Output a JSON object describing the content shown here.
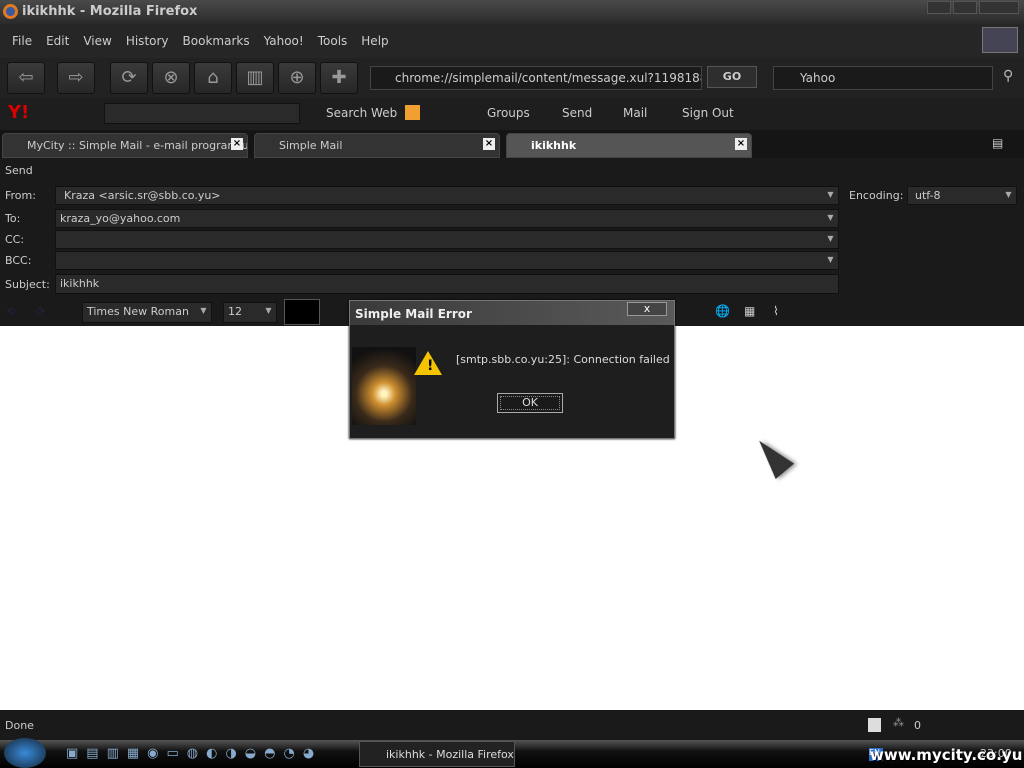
{
  "window": {
    "title": "ikikhhk - Mozilla Firefox"
  },
  "menu": [
    "File",
    "Edit",
    "View",
    "History",
    "Bookmarks",
    "Yahoo!",
    "Tools",
    "Help"
  ],
  "nav": {
    "url": "chrome://simplemail/content/message.xul?1198188542328",
    "go": "GO",
    "search_engine": "Yahoo"
  },
  "yahoo_toolbar": {
    "search_web": "Search Web",
    "groups": "Groups",
    "send": "Send",
    "mail": "Mail",
    "sign_out": "Sign Out"
  },
  "tabs": [
    {
      "label": "MyCity :: Simple Mail - e-mail program u..."
    },
    {
      "label": "Simple Mail"
    },
    {
      "label": "ikikhhk"
    }
  ],
  "compose": {
    "send": "Send",
    "from_label": "From:",
    "from": "Kraza <arsic.sr@sbb.co.yu>",
    "to_label": "To:",
    "to": "kraza_yo@yahoo.com",
    "cc_label": "CC:",
    "cc": "",
    "bcc_label": "BCC:",
    "bcc": "",
    "subject_label": "Subject:",
    "subject": "ikikhhk",
    "encoding_label": "Encoding:",
    "encoding": "utf-8",
    "font": "Times New Roman",
    "size": "12"
  },
  "dialog": {
    "title": "Simple Mail Error",
    "close": "x",
    "message": "[smtp.sbb.co.yu:25]: Connection failed",
    "ok": "OK"
  },
  "status": {
    "text": "Done",
    "count": "0"
  },
  "taskbar": {
    "task": "ikikhhk - Mozilla Firefox",
    "clock": "23:00",
    "lang": "EN"
  },
  "watermark": "www.mycity.co.yu"
}
